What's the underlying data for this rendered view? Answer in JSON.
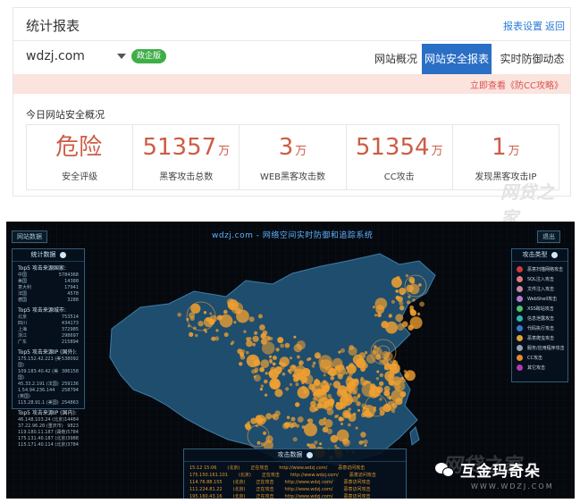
{
  "header": {
    "title": "统计报表",
    "settings_link": "报表设置",
    "back_link": "返回"
  },
  "site": {
    "domain": "wdzj.com",
    "badge": "政企版"
  },
  "tabs": [
    {
      "label": "网站概况",
      "active": false
    },
    {
      "label": "网站安全报表",
      "active": true
    },
    {
      "label": "实时防御动态",
      "active": false
    }
  ],
  "alert_link": "立即查看《防CC攻略》",
  "overview": {
    "title": "今日网站安全概况",
    "stats": [
      {
        "value": "危险",
        "unit": "",
        "label": "安全评级"
      },
      {
        "value": "51357",
        "unit": "万",
        "label": "黑客攻击总数"
      },
      {
        "value": "3",
        "unit": "万",
        "label": "WEB黑客攻击数"
      },
      {
        "value": "51354",
        "unit": "万",
        "label": "CC攻击"
      },
      {
        "value": "1",
        "unit": "万",
        "label": "发现黑客攻击IP"
      }
    ]
  },
  "watermark_top": "网贷之家",
  "dark": {
    "title": "wdzj.com - 网络空间实时防御和追踪系统",
    "left_button": "网站数据",
    "right_button": "退出",
    "left_panel": {
      "title": "统计数据",
      "sections": [
        {
          "heading": "Top5 攻击来源国家:",
          "rows": [
            [
              "中国",
              "5784368"
            ],
            [
              "美国",
              "14388"
            ],
            [
              "意大利",
              "17941"
            ],
            [
              "法国",
              "4578"
            ],
            [
              "德国",
              "3288"
            ]
          ]
        },
        {
          "heading": "Top5 攻击来源城市:",
          "rows": [
            [
              "北京",
              "753514"
            ],
            [
              "四川",
              "434173"
            ],
            [
              "上海",
              "372985"
            ],
            [
              "浙江",
              "298697"
            ],
            [
              "广东",
              "215894"
            ]
          ]
        },
        {
          "heading": "Top5 攻击来源IP (国外):",
          "rows": [
            [
              "175.152.42.221 (美国)",
              "538092"
            ],
            [
              "109.183.40.42 (美国)",
              "386158"
            ],
            [
              "45.33.2.191 (法国)",
              "259136"
            ],
            [
              "1.54.94.236.144 (英国)",
              "258794"
            ],
            [
              "115.28.91.1 (美国)",
              "254863"
            ]
          ]
        },
        {
          "heading": "Top5 攻击来源IP (国内):",
          "rows": [
            [
              "46.148.103.24 (北京)",
              "14484"
            ],
            [
              "37.22.96.28 (重庆市)",
              "9823"
            ],
            [
              "119.180.11.187 (湖南)",
              "5784"
            ],
            [
              "175.131.40.187 (北京)",
              "3988"
            ],
            [
              "115.171.40.114 (北京)",
              "3784"
            ]
          ]
        }
      ]
    },
    "right_panel": {
      "title": "攻击类型",
      "items": [
        {
          "label": "恶意扫描网络攻击",
          "color": "#d23a3a"
        },
        {
          "label": "SQL注入攻击",
          "color": "#e07b7b"
        },
        {
          "label": "文件注入攻击",
          "color": "#c98aa0"
        },
        {
          "label": "WebShell攻击",
          "color": "#b07cc8"
        },
        {
          "label": "XSS跨站攻击",
          "color": "#4fc26a"
        },
        {
          "label": "信息泄露攻击",
          "color": "#2fb8b0"
        },
        {
          "label": "代码执行攻击",
          "color": "#3a79c9"
        },
        {
          "label": "恶意爬虫攻击",
          "color": "#e0a23a"
        },
        {
          "label": "服务/应用程序攻击",
          "color": "#9aa3ad"
        },
        {
          "label": "CC攻击",
          "color": "#e88a2a"
        },
        {
          "label": "其它攻击",
          "color": "#b03ab0"
        }
      ]
    },
    "bottom_panel": {
      "title": "攻击数据",
      "rows": [
        [
          "15:12 15:06",
          "(北京)",
          "正在攻击",
          "http://www.wdzj.com/",
          "恶意访问攻击"
        ],
        [
          "175.150.161.101",
          "(北京)",
          "正在攻击",
          "http://www.wdzj.com/",
          "恶意访问攻击"
        ],
        [
          "114.76.88.155",
          "(北京)",
          "正在攻击",
          "http://www.wdzj.com/",
          "恶意访问攻击"
        ],
        [
          "111.224.81.22",
          "(北京)",
          "正在攻击",
          "http://www.wdzj.com/",
          "恶意访问攻击"
        ],
        [
          "195.160.43.16",
          "(北京)",
          "正在攻击",
          "http://www.wdzj.com/",
          "恶意访问攻击"
        ]
      ]
    },
    "wechat_label": "互金玛奇朵",
    "watermark": "网贷之家",
    "watermark_url": "WWW.WDZJ.COM"
  }
}
